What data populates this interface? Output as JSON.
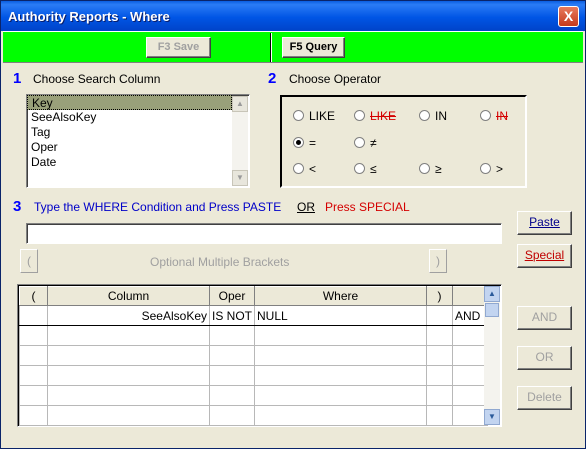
{
  "window": {
    "title": "Authority Reports - Where",
    "close_label": "X"
  },
  "toolbar": {
    "save_label": "F3 Save",
    "query_label": "F5 Query"
  },
  "step1": {
    "number": "1",
    "label": "Choose Search Column",
    "columns": [
      "Key",
      "SeeAlsoKey",
      "Tag",
      "Oper",
      "Date"
    ],
    "selected": "Key"
  },
  "step2": {
    "number": "2",
    "label": "Choose Operator",
    "operators": [
      "LIKE",
      "LIKE",
      "IN",
      "IN",
      "=",
      "≠",
      "<",
      "≤",
      "≥",
      ">"
    ],
    "selected": "="
  },
  "step3": {
    "number": "3",
    "label": "Type the WHERE Condition and Press PASTE",
    "or_label": "OR",
    "special_label": "Press SPECIAL",
    "where_value": ""
  },
  "brackets": {
    "open": "(",
    "close": ")",
    "label": "Optional Multiple Brackets"
  },
  "buttons": {
    "paste": "Paste",
    "special": "Special",
    "and": "AND",
    "or": "OR",
    "delete": "Delete"
  },
  "grid": {
    "headers": [
      "(",
      "Column",
      "Oper",
      "Where",
      ")",
      ""
    ],
    "rows": [
      [
        "",
        "SeeAlsoKey",
        "IS NOT",
        "NULL",
        "",
        "AND"
      ]
    ]
  },
  "colors": {
    "toolbar": "#00ff00",
    "step_number": "#0000ff",
    "negated": "#d40000"
  }
}
